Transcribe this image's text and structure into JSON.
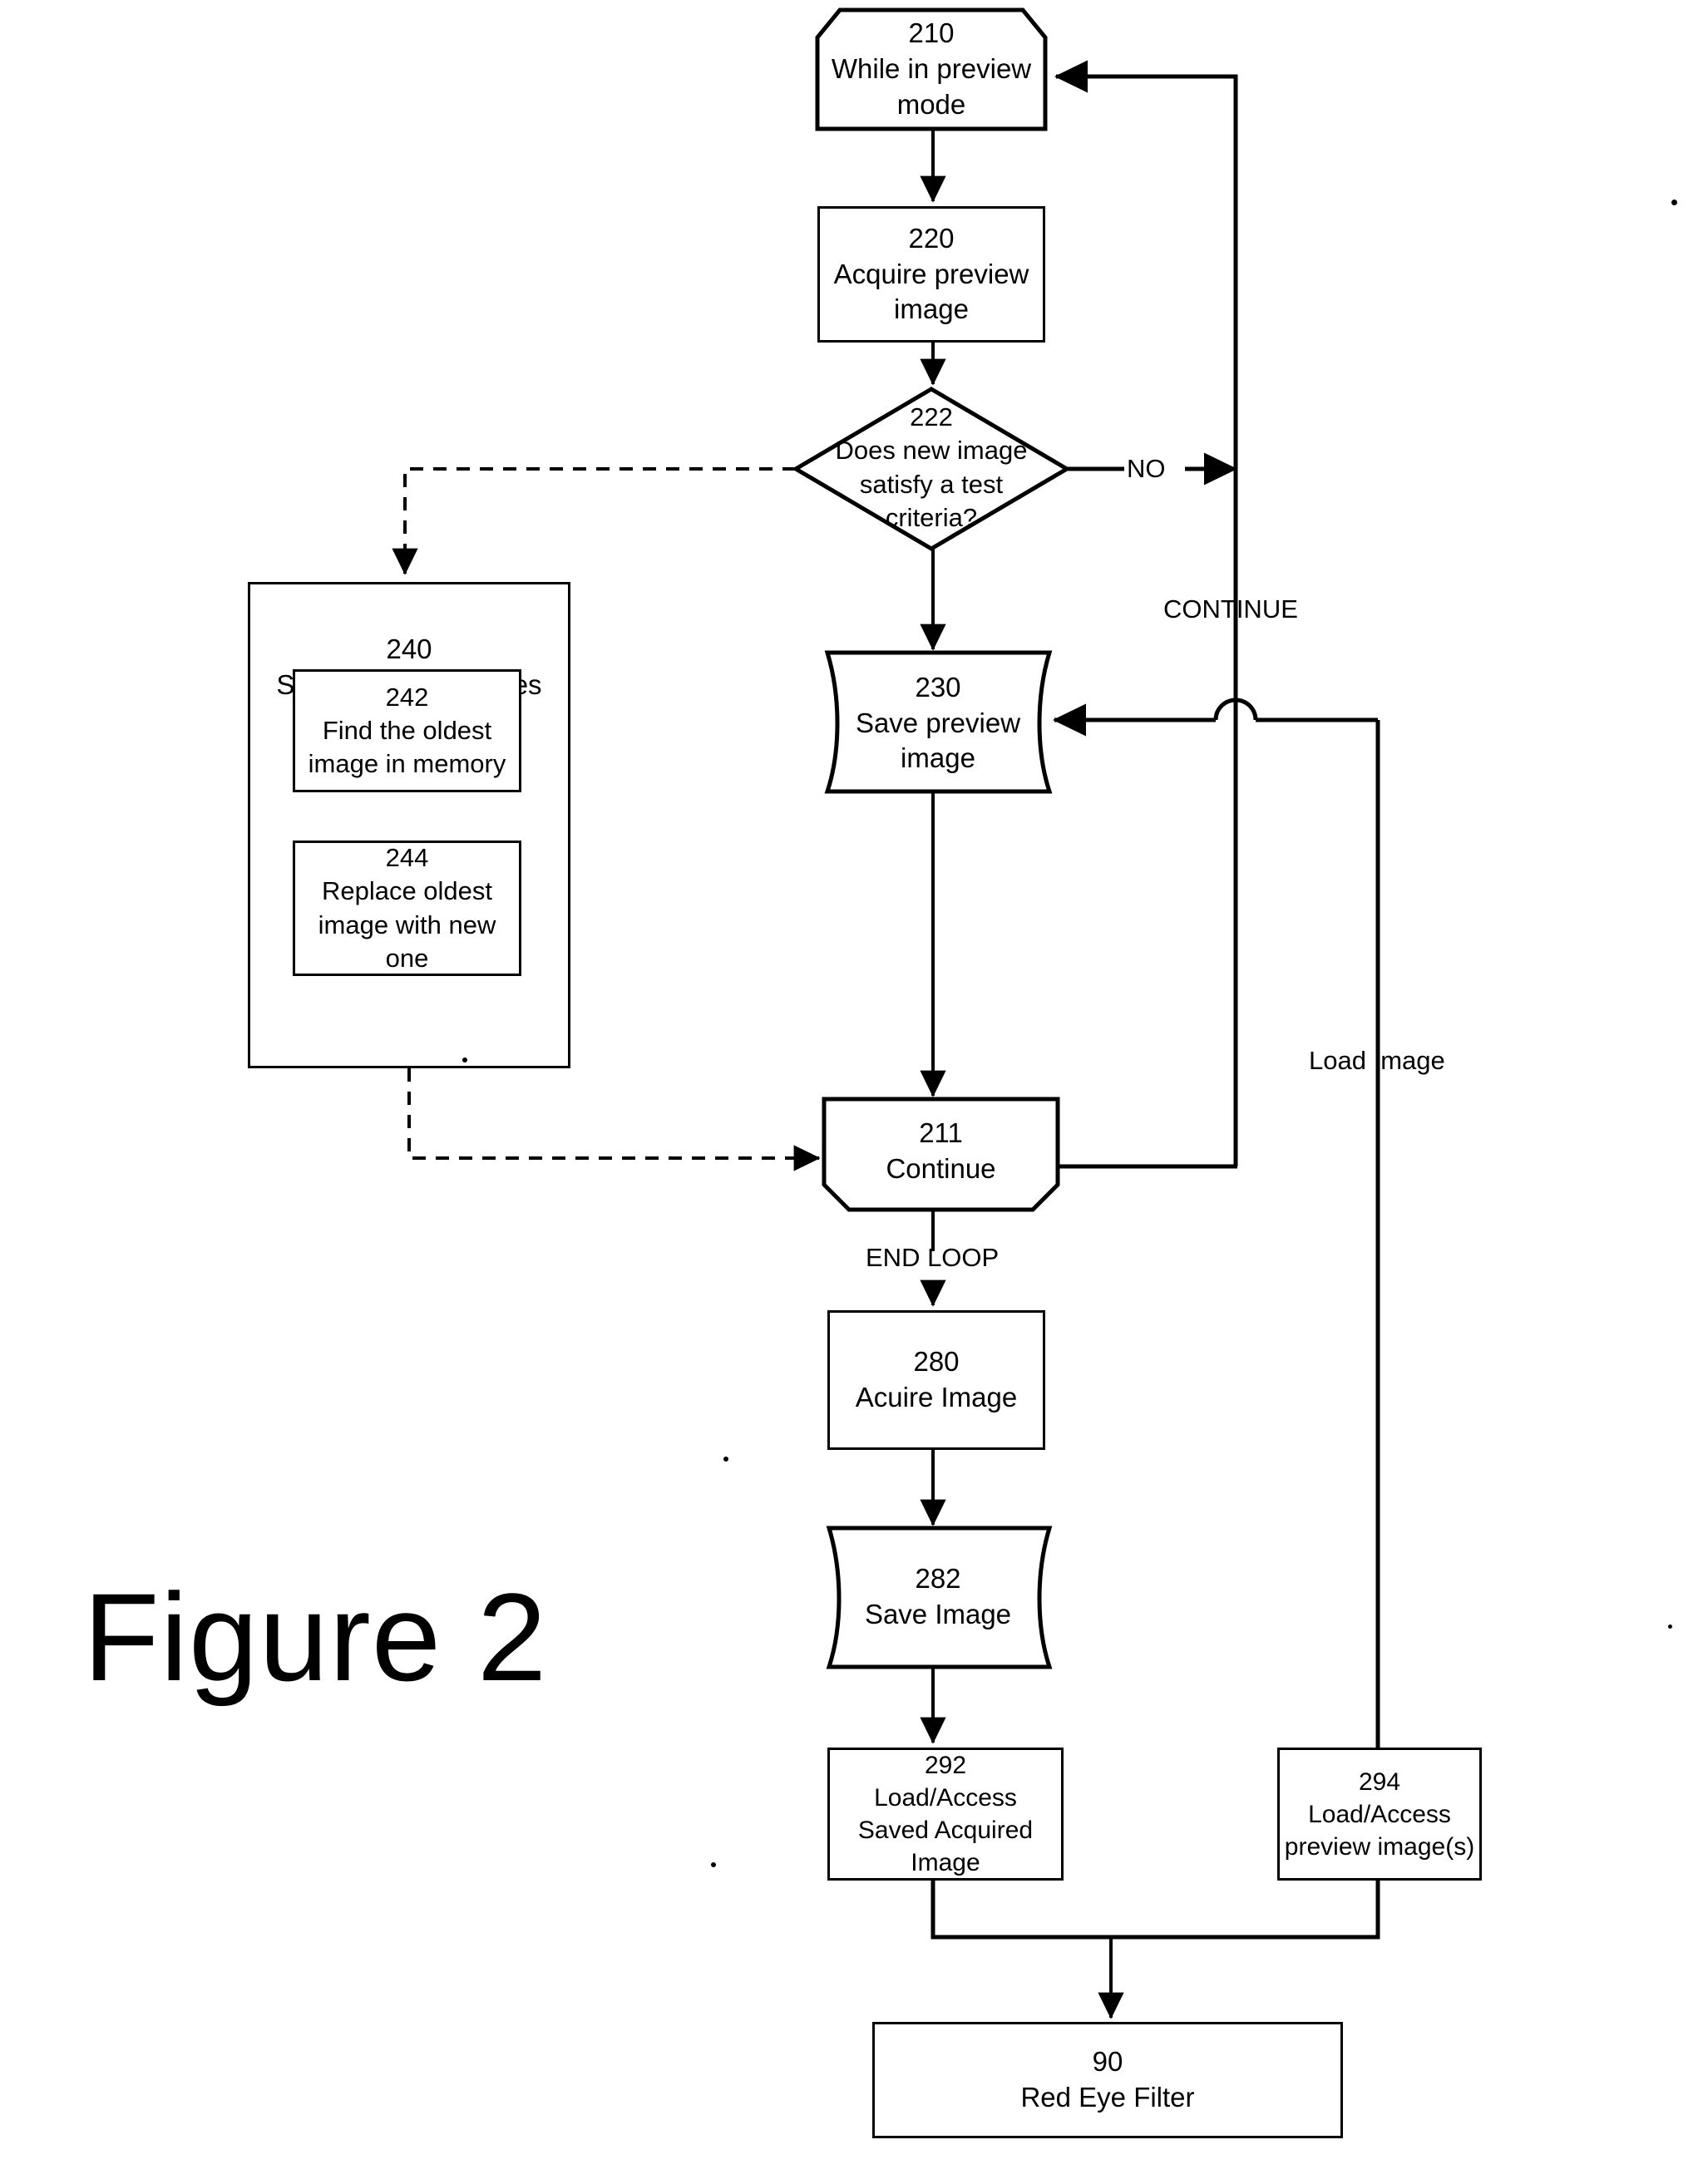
{
  "figure": {
    "caption": "Figure 2"
  },
  "colors": {
    "ink": "#000000",
    "paper": "#ffffff"
  },
  "nodes": {
    "n210": {
      "num": "210",
      "label": "While in preview\nmode",
      "shape": "loop-start"
    },
    "n220": {
      "num": "220",
      "label": "Acquire preview\nimage",
      "shape": "process"
    },
    "n222": {
      "num": "222",
      "label": "Does new image\nsatisfy a test\ncriteria?",
      "shape": "decision"
    },
    "n230": {
      "num": "230",
      "label": "Save preview\nimage",
      "shape": "stored-data"
    },
    "n240": {
      "num": "240",
      "label": "Save Preview Images",
      "shape": "group"
    },
    "n242": {
      "num": "242",
      "label": "Find the oldest\nimage in memory",
      "shape": "process"
    },
    "n244": {
      "num": "244",
      "label": "Replace oldest\nimage with new\none",
      "shape": "process"
    },
    "n211": {
      "num": "211",
      "label": "Continue",
      "shape": "loop-end"
    },
    "n280": {
      "num": "280",
      "label": "Acuire Image",
      "shape": "process"
    },
    "n282": {
      "num": "282",
      "label": "Save Image",
      "shape": "stored-data"
    },
    "n292": {
      "num": "292",
      "label": "Load/Access\nSaved Acquired\nImage",
      "shape": "process"
    },
    "n294": {
      "num": "294",
      "label": "Load/Access\npreview image(s)",
      "shape": "process"
    },
    "n90": {
      "num": "90",
      "label": "Red Eye Filter",
      "shape": "process"
    }
  },
  "edge_labels": {
    "no": "NO",
    "continue": "CONTINUE",
    "end_loop": "END LOOP",
    "load_image": "Load Image"
  },
  "chart_data": {
    "type": "diagram",
    "title": "Figure 2",
    "nodes": [
      {
        "id": "210",
        "text": "While in preview mode",
        "shape": "loop-start"
      },
      {
        "id": "220",
        "text": "Acquire preview image",
        "shape": "process"
      },
      {
        "id": "222",
        "text": "Does new image satisfy a test criteria?",
        "shape": "decision"
      },
      {
        "id": "230",
        "text": "Save preview image",
        "shape": "stored-data"
      },
      {
        "id": "240",
        "text": "Save Preview Images",
        "shape": "group"
      },
      {
        "id": "242",
        "text": "Find the oldest image in memory",
        "shape": "process"
      },
      {
        "id": "244",
        "text": "Replace oldest image with new one",
        "shape": "process"
      },
      {
        "id": "211",
        "text": "Continue",
        "shape": "loop-end"
      },
      {
        "id": "280",
        "text": "Acuire Image",
        "shape": "process"
      },
      {
        "id": "282",
        "text": "Save Image",
        "shape": "stored-data"
      },
      {
        "id": "292",
        "text": "Load/Access Saved Acquired Image",
        "shape": "process"
      },
      {
        "id": "294",
        "text": "Load/Access preview image(s)",
        "shape": "process"
      },
      {
        "id": "90",
        "text": "Red Eye Filter",
        "shape": "process"
      }
    ],
    "edges": [
      {
        "from": "210",
        "to": "220",
        "style": "solid"
      },
      {
        "from": "220",
        "to": "222",
        "style": "solid"
      },
      {
        "from": "222",
        "to": "240",
        "style": "dashed"
      },
      {
        "from": "222",
        "to": "230",
        "style": "solid"
      },
      {
        "from": "222",
        "to": "210",
        "style": "solid",
        "label": "NO"
      },
      {
        "from": "240",
        "to": "211",
        "style": "dashed"
      },
      {
        "from": "230",
        "to": "211",
        "style": "solid"
      },
      {
        "from": "211",
        "to": "210",
        "style": "solid",
        "label": "CONTINUE"
      },
      {
        "from": "211",
        "to": "280",
        "style": "solid",
        "label": "END LOOP"
      },
      {
        "from": "280",
        "to": "282",
        "style": "solid"
      },
      {
        "from": "282",
        "to": "292",
        "style": "solid"
      },
      {
        "from": "294",
        "to": "230",
        "style": "solid",
        "label": "Load Image"
      },
      {
        "from": "292",
        "to": "90",
        "style": "solid"
      },
      {
        "from": "294",
        "to": "90",
        "style": "solid"
      }
    ]
  }
}
